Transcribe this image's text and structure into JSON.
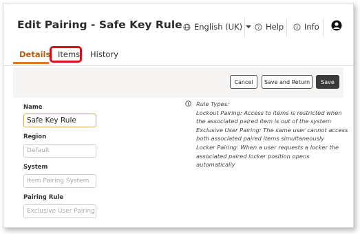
{
  "header": {
    "title": "Edit Pairing - Safe Key Rule",
    "language": "English (UK)",
    "help_label": "Help",
    "info_label": "Info"
  },
  "tabs": [
    {
      "label": "Details",
      "active": true
    },
    {
      "label": "Items",
      "active": false
    },
    {
      "label": "History",
      "active": false
    }
  ],
  "toolbar": {
    "cancel_label": "Cancel",
    "save_return_label": "Save and Return",
    "save_label": "Save"
  },
  "form": {
    "name_label": "Name",
    "name_value": "Safe Key Rule",
    "region_label": "Region",
    "region_placeholder": "Default",
    "system_label": "System",
    "system_placeholder": "Item Pairing System",
    "rule_label": "Pairing Rule",
    "rule_placeholder": "Exclusive User Pairing"
  },
  "rule_types": {
    "heading": "Rule Types:",
    "lines": [
      "Lockout Pairing: Access to items is restricted when",
      "the associated paired item is out of the system",
      "Exclusive User Pairing: The same user cannot access",
      "both associated paired items simultaneously",
      "Locker Pairing: When a user requests a locker the",
      "associated paired locker position opens",
      "automatically"
    ]
  },
  "colors": {
    "accent": "#d97a25",
    "highlight": "#d0111b",
    "primary_button": "#3a3a3a"
  },
  "icons": {
    "language": "globe-icon",
    "help": "question-circle-icon",
    "info": "info-circle-icon",
    "user": "user-avatar-icon",
    "dropdown": "caret-down-icon"
  }
}
